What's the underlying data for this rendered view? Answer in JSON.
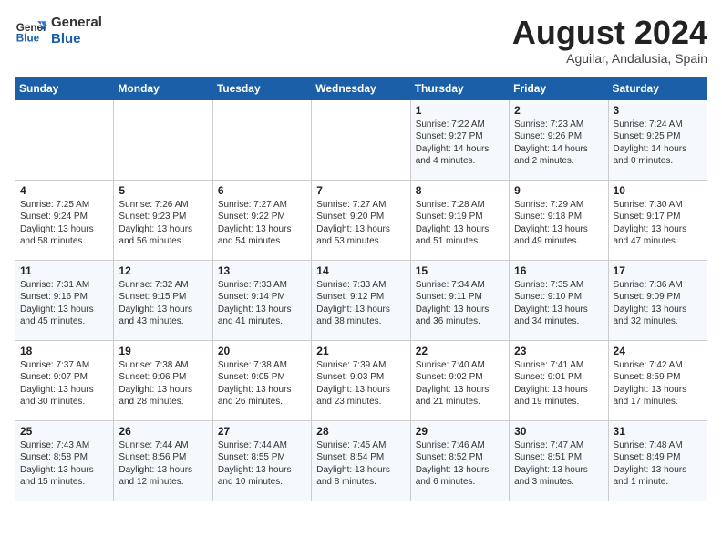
{
  "header": {
    "logo_line1": "General",
    "logo_line2": "Blue",
    "month": "August 2024",
    "location": "Aguilar, Andalusia, Spain"
  },
  "weekdays": [
    "Sunday",
    "Monday",
    "Tuesday",
    "Wednesday",
    "Thursday",
    "Friday",
    "Saturday"
  ],
  "weeks": [
    [
      {
        "day": "",
        "info": ""
      },
      {
        "day": "",
        "info": ""
      },
      {
        "day": "",
        "info": ""
      },
      {
        "day": "",
        "info": ""
      },
      {
        "day": "1",
        "info": "Sunrise: 7:22 AM\nSunset: 9:27 PM\nDaylight: 14 hours\nand 4 minutes."
      },
      {
        "day": "2",
        "info": "Sunrise: 7:23 AM\nSunset: 9:26 PM\nDaylight: 14 hours\nand 2 minutes."
      },
      {
        "day": "3",
        "info": "Sunrise: 7:24 AM\nSunset: 9:25 PM\nDaylight: 14 hours\nand 0 minutes."
      }
    ],
    [
      {
        "day": "4",
        "info": "Sunrise: 7:25 AM\nSunset: 9:24 PM\nDaylight: 13 hours\nand 58 minutes."
      },
      {
        "day": "5",
        "info": "Sunrise: 7:26 AM\nSunset: 9:23 PM\nDaylight: 13 hours\nand 56 minutes."
      },
      {
        "day": "6",
        "info": "Sunrise: 7:27 AM\nSunset: 9:22 PM\nDaylight: 13 hours\nand 54 minutes."
      },
      {
        "day": "7",
        "info": "Sunrise: 7:27 AM\nSunset: 9:20 PM\nDaylight: 13 hours\nand 53 minutes."
      },
      {
        "day": "8",
        "info": "Sunrise: 7:28 AM\nSunset: 9:19 PM\nDaylight: 13 hours\nand 51 minutes."
      },
      {
        "day": "9",
        "info": "Sunrise: 7:29 AM\nSunset: 9:18 PM\nDaylight: 13 hours\nand 49 minutes."
      },
      {
        "day": "10",
        "info": "Sunrise: 7:30 AM\nSunset: 9:17 PM\nDaylight: 13 hours\nand 47 minutes."
      }
    ],
    [
      {
        "day": "11",
        "info": "Sunrise: 7:31 AM\nSunset: 9:16 PM\nDaylight: 13 hours\nand 45 minutes."
      },
      {
        "day": "12",
        "info": "Sunrise: 7:32 AM\nSunset: 9:15 PM\nDaylight: 13 hours\nand 43 minutes."
      },
      {
        "day": "13",
        "info": "Sunrise: 7:33 AM\nSunset: 9:14 PM\nDaylight: 13 hours\nand 41 minutes."
      },
      {
        "day": "14",
        "info": "Sunrise: 7:33 AM\nSunset: 9:12 PM\nDaylight: 13 hours\nand 38 minutes."
      },
      {
        "day": "15",
        "info": "Sunrise: 7:34 AM\nSunset: 9:11 PM\nDaylight: 13 hours\nand 36 minutes."
      },
      {
        "day": "16",
        "info": "Sunrise: 7:35 AM\nSunset: 9:10 PM\nDaylight: 13 hours\nand 34 minutes."
      },
      {
        "day": "17",
        "info": "Sunrise: 7:36 AM\nSunset: 9:09 PM\nDaylight: 13 hours\nand 32 minutes."
      }
    ],
    [
      {
        "day": "18",
        "info": "Sunrise: 7:37 AM\nSunset: 9:07 PM\nDaylight: 13 hours\nand 30 minutes."
      },
      {
        "day": "19",
        "info": "Sunrise: 7:38 AM\nSunset: 9:06 PM\nDaylight: 13 hours\nand 28 minutes."
      },
      {
        "day": "20",
        "info": "Sunrise: 7:38 AM\nSunset: 9:05 PM\nDaylight: 13 hours\nand 26 minutes."
      },
      {
        "day": "21",
        "info": "Sunrise: 7:39 AM\nSunset: 9:03 PM\nDaylight: 13 hours\nand 23 minutes."
      },
      {
        "day": "22",
        "info": "Sunrise: 7:40 AM\nSunset: 9:02 PM\nDaylight: 13 hours\nand 21 minutes."
      },
      {
        "day": "23",
        "info": "Sunrise: 7:41 AM\nSunset: 9:01 PM\nDaylight: 13 hours\nand 19 minutes."
      },
      {
        "day": "24",
        "info": "Sunrise: 7:42 AM\nSunset: 8:59 PM\nDaylight: 13 hours\nand 17 minutes."
      }
    ],
    [
      {
        "day": "25",
        "info": "Sunrise: 7:43 AM\nSunset: 8:58 PM\nDaylight: 13 hours\nand 15 minutes."
      },
      {
        "day": "26",
        "info": "Sunrise: 7:44 AM\nSunset: 8:56 PM\nDaylight: 13 hours\nand 12 minutes."
      },
      {
        "day": "27",
        "info": "Sunrise: 7:44 AM\nSunset: 8:55 PM\nDaylight: 13 hours\nand 10 minutes."
      },
      {
        "day": "28",
        "info": "Sunrise: 7:45 AM\nSunset: 8:54 PM\nDaylight: 13 hours\nand 8 minutes."
      },
      {
        "day": "29",
        "info": "Sunrise: 7:46 AM\nSunset: 8:52 PM\nDaylight: 13 hours\nand 6 minutes."
      },
      {
        "day": "30",
        "info": "Sunrise: 7:47 AM\nSunset: 8:51 PM\nDaylight: 13 hours\nand 3 minutes."
      },
      {
        "day": "31",
        "info": "Sunrise: 7:48 AM\nSunset: 8:49 PM\nDaylight: 13 hours\nand 1 minute."
      }
    ]
  ]
}
